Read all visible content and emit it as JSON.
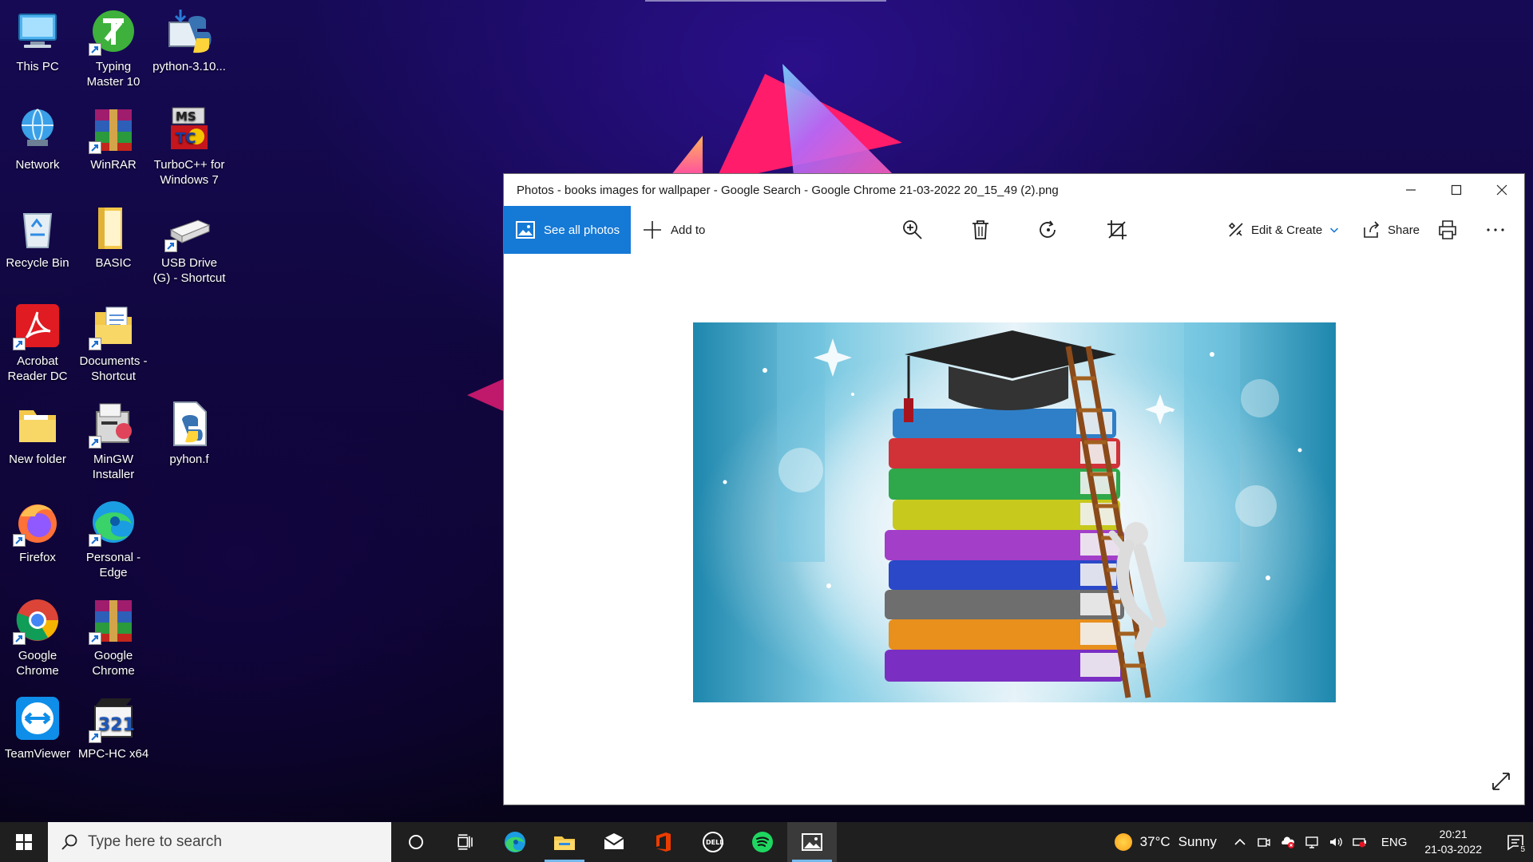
{
  "desktop": {
    "icons": [
      {
        "label": "This PC",
        "icon": "this-pc-icon"
      },
      {
        "label": "Typing Master 10",
        "icon": "typing-master-icon"
      },
      {
        "label": "python-3.10...",
        "icon": "python-installer-icon"
      },
      {
        "label": "Network",
        "icon": "network-icon"
      },
      {
        "label": "WinRAR",
        "icon": "winrar-icon"
      },
      {
        "label": "TurboC++ for Windows 7",
        "icon": "turbo-cpp-icon"
      },
      {
        "label": "Recycle Bin",
        "icon": "recycle-bin-icon"
      },
      {
        "label": "BASIC",
        "icon": "folder-icon"
      },
      {
        "label": "USB Drive (G) - Shortcut",
        "icon": "usb-drive-icon"
      },
      {
        "label": "Acrobat Reader DC",
        "icon": "acrobat-icon"
      },
      {
        "label": "Documents - Shortcut",
        "icon": "documents-folder-icon"
      },
      {
        "label": "New folder",
        "icon": "folder-icon"
      },
      {
        "label": "MinGW Installer",
        "icon": "mingw-icon"
      },
      {
        "label": "pyhon.f",
        "icon": "python-file-icon"
      },
      {
        "label": "Firefox",
        "icon": "firefox-icon"
      },
      {
        "label": "Personal - Edge",
        "icon": "edge-icon"
      },
      {
        "label": "Google Chrome",
        "icon": "chrome-icon"
      },
      {
        "label": "Google Chrome",
        "icon": "winrar-icon"
      },
      {
        "label": "TeamViewer",
        "icon": "teamviewer-icon"
      },
      {
        "label": "MPC-HC x64",
        "icon": "mpc-hc-icon"
      }
    ]
  },
  "photos": {
    "title": "Photos - books images for wallpaper - Google Search - Google Chrome 21-03-2022 20_15_49 (2).png",
    "see_all_label": "See all photos",
    "add_to_label": "Add to",
    "edit_create_label": "Edit & Create",
    "share_label": "Share"
  },
  "taskbar": {
    "search_placeholder": "Type here to search",
    "weather_temp": "37°C",
    "weather_desc": "Sunny",
    "language": "ENG",
    "time": "20:21",
    "date": "21-03-2022",
    "notification_count": "5"
  },
  "colors": {
    "accent": "#1579d6",
    "taskbar": "#1f1f1f"
  }
}
